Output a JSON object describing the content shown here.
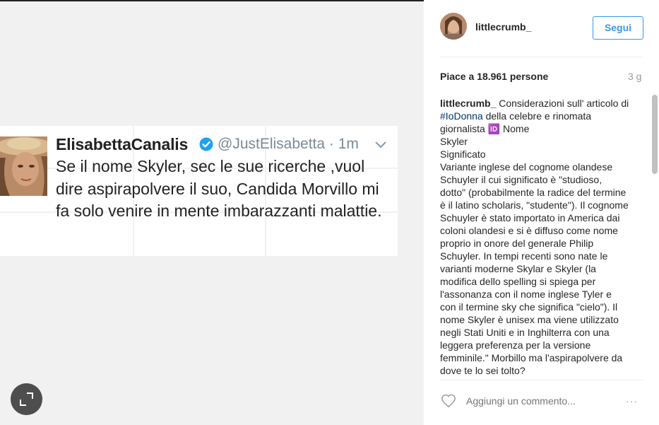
{
  "tweet": {
    "name": "ElisabettaCanalis",
    "handle": "@JustElisabetta · 1m",
    "text": "Se il nome Skyler, sec le sue ricerche ,vuol dire aspirapolvere il suo, Candida Morvillo mi fa solo venire in mente imbarazzanti malattie."
  },
  "header": {
    "username": "littlecrumb_",
    "follow_label": "Segui"
  },
  "stats": {
    "likes": "Piace a 18.961 persone",
    "age": "3 g"
  },
  "caption": {
    "user": "littlecrumb_",
    "intro": " Considerazioni sull' articolo di ",
    "hashtag": "#IoDonna",
    "body": " della celebre e rinomata giornalista 🆔 Nome\nSkyler\nSignificato\nVariante inglese del cognome olandese Schuyler il cui significato è \"studioso, dotto\" (probabilmente la radice del termine è il latino scholaris, \"studente\"). Il cognome Schuyler è stato importato in America dai coloni olandesi e si è diffuso come nome proprio in onore del generale Philip Schuyler. In tempi recenti sono nate le varianti moderne Skylar e Skyler (la modifica dello spelling si spiega per l'assonanza con il nome inglese Tyler e con il termine sky che significa \"cielo\"). Il nome Skyler è unisex ma viene utilizzato negli Stati Uniti e in Inghilterra con una leggera preferenza per la versione femminile.\" Morbillo ma l'aspirapolvere da dove te lo sei tolto?"
  },
  "comment": {
    "placeholder": "Aggiungi un commento..."
  },
  "more_label": "···",
  "colors": {
    "accent": "#3897f0",
    "hashtag": "#003569",
    "twitter_verified": "#1da1f2"
  }
}
